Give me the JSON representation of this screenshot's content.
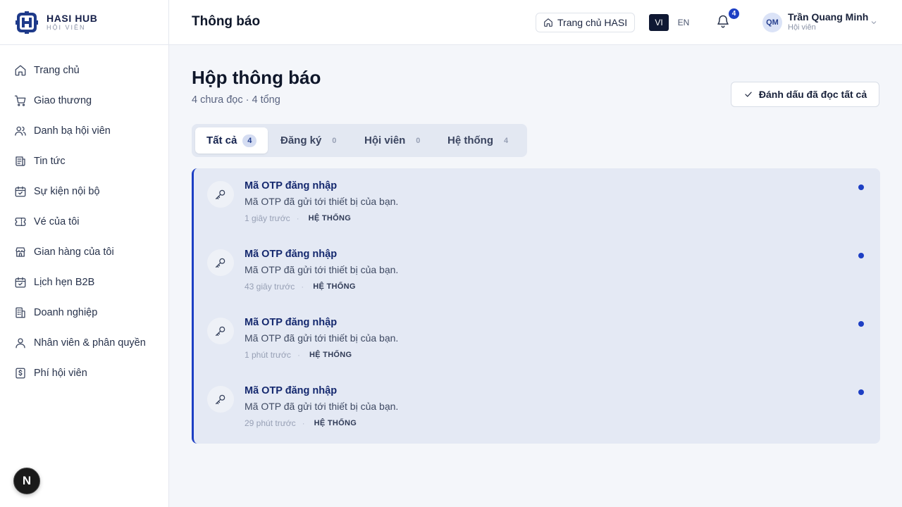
{
  "brand": {
    "name": "HASI HUB",
    "subtitle": "HỘI VIÊN"
  },
  "sidebar": {
    "items": [
      {
        "label": "Trang chủ",
        "icon": "home-icon"
      },
      {
        "label": "Giao thương",
        "icon": "cart-icon"
      },
      {
        "label": "Danh bạ hội viên",
        "icon": "users-icon"
      },
      {
        "label": "Tin tức",
        "icon": "news-icon"
      },
      {
        "label": "Sự kiện nội bộ",
        "icon": "calendar-icon"
      },
      {
        "label": "Vé của tôi",
        "icon": "ticket-icon"
      },
      {
        "label": "Gian hàng của tôi",
        "icon": "store-icon"
      },
      {
        "label": "Lịch hẹn B2B",
        "icon": "calendar-check-icon"
      },
      {
        "label": "Doanh nghiệp",
        "icon": "building-icon"
      },
      {
        "label": "Nhân viên & phân quyền",
        "icon": "user-icon"
      },
      {
        "label": "Phí hội viên",
        "icon": "dollar-icon"
      }
    ]
  },
  "dev_badge": {
    "letter": "N"
  },
  "header": {
    "title": "Thông báo",
    "home_button": "Trang chủ HASI",
    "lang_vi": "VI",
    "lang_en": "EN",
    "bell_count": "4",
    "user": {
      "initials": "QM",
      "name": "Trần Quang Minh",
      "role": "Hội viên"
    }
  },
  "main": {
    "title": "Hộp thông báo",
    "subtitle": "4 chưa đọc · 4 tổng",
    "mark_all_read": "Đánh dấu đã đọc tất cả",
    "tabs": [
      {
        "label": "Tất cả",
        "count": "4",
        "active": true
      },
      {
        "label": "Đăng ký",
        "count": "0",
        "active": false
      },
      {
        "label": "Hội viên",
        "count": "0",
        "active": false
      },
      {
        "label": "Hệ thống",
        "count": "4",
        "active": false
      }
    ],
    "notifications": [
      {
        "title": "Mã OTP đăng nhập",
        "body": "Mã OTP đã gửi tới thiết bị của bạn.",
        "time": "1 giây trước",
        "tag": "HỆ THỐNG",
        "unread": true
      },
      {
        "title": "Mã OTP đăng nhập",
        "body": "Mã OTP đã gửi tới thiết bị của bạn.",
        "time": "43 giây trước",
        "tag": "HỆ THỐNG",
        "unread": true
      },
      {
        "title": "Mã OTP đăng nhập",
        "body": "Mã OTP đã gửi tới thiết bị của bạn.",
        "time": "1 phút trước",
        "tag": "HỆ THỐNG",
        "unread": true
      },
      {
        "title": "Mã OTP đăng nhập",
        "body": "Mã OTP đã gửi tới thiết bị của bạn.",
        "time": "29 phút trước",
        "tag": "HỆ THỐNG",
        "unread": true
      }
    ]
  },
  "colors": {
    "accent": "#1d3fc4",
    "brand": "#1e3a8a"
  }
}
